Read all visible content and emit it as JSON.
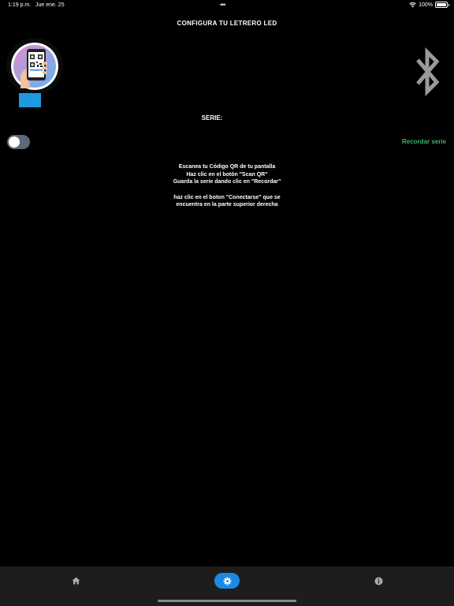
{
  "status": {
    "time": "1:19 p.m.",
    "date": "Jue ene. 25",
    "battery": "100%",
    "icons": [
      "wifi-icon",
      "battery-icon"
    ]
  },
  "header": {
    "title": "CONFIGURA TU LETRERO LED"
  },
  "scan": {
    "icon": "qr-scan-icon",
    "bluetooth_icon": "bluetooth-icon"
  },
  "serie": {
    "label": "SERIE:",
    "remember_label": "Recordar serie",
    "toggle_on": false
  },
  "instructions": {
    "lines": [
      "Escanea tu Código QR de tu pantalla",
      "Haz clic en el botón \"Scan QR\"",
      "Guarda la serie dando clic en \"Recordar\"",
      "haz clic en el boton \"Conectarse\" que se",
      "encuentra en la parte superior derecha"
    ]
  },
  "tabs": [
    {
      "icon": "home-icon",
      "active": false
    },
    {
      "icon": "gear-icon",
      "active": true
    },
    {
      "icon": "info-icon",
      "active": false
    }
  ],
  "colors": {
    "background": "#000000",
    "accent_green": "#3cb371",
    "active_tab": "#1e88e5",
    "tab_bar": "#1d1d1d",
    "bluetooth": "#9a9a9a"
  }
}
